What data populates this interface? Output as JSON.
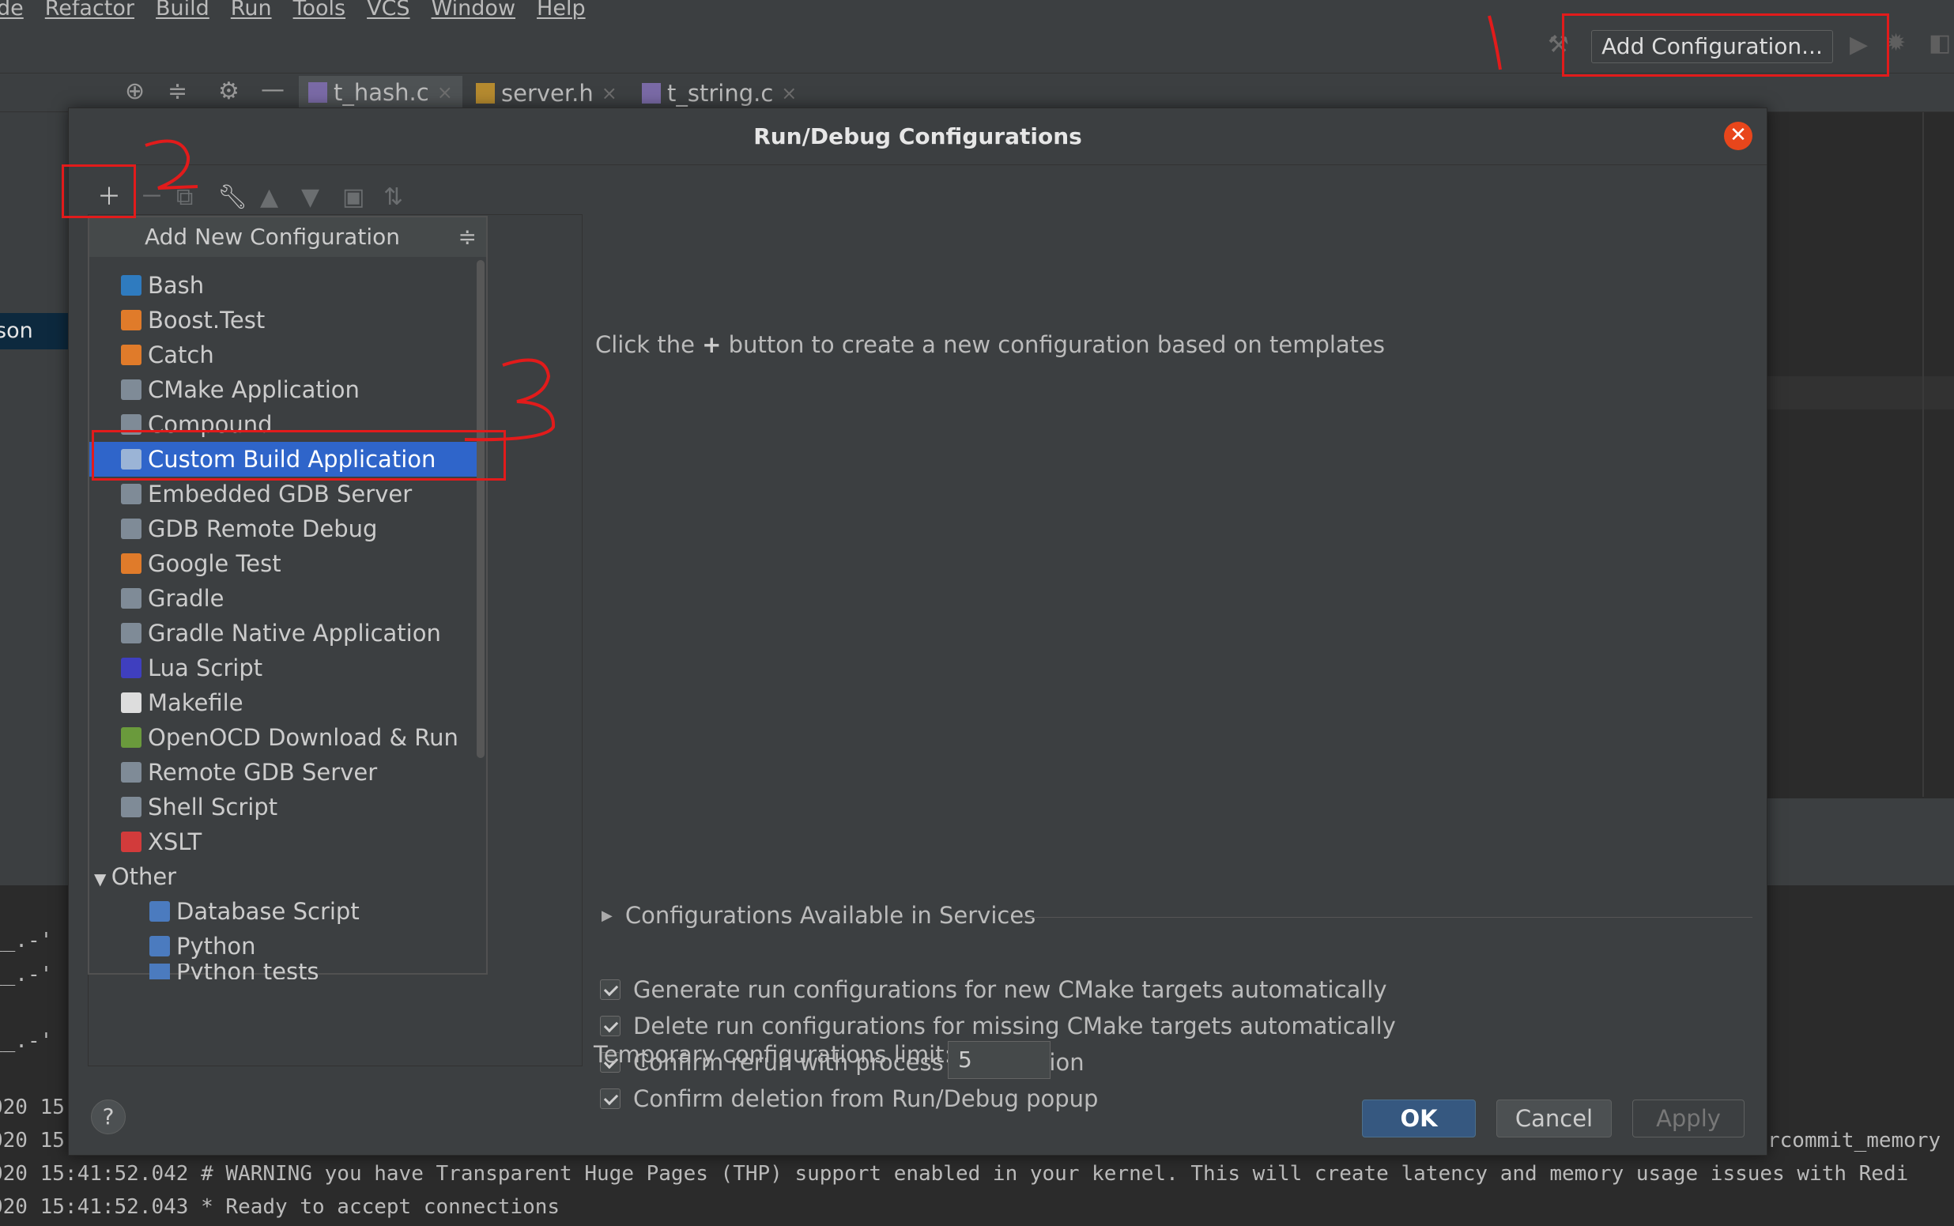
{
  "menubar": {
    "items": [
      "de",
      "Refactor",
      "Build",
      "Run",
      "Tools",
      "VCS",
      "Window",
      "Help"
    ]
  },
  "toolbar": {
    "add_configuration_label": "Add Configuration..."
  },
  "editor_tabs": [
    {
      "label": "t_hash.c",
      "close": "×",
      "active": true
    },
    {
      "label": "server.h",
      "close": "×",
      "active": false
    },
    {
      "label": "t_string.c",
      "close": "×",
      "active": false
    }
  ],
  "left_panel": {
    "selected_item_fragment": "son"
  },
  "dialog": {
    "title": "Run/Debug Configurations",
    "close_glyph": "✕",
    "popup": {
      "header": "Add New Configuration",
      "items": [
        {
          "label": "Bash",
          "icon": "bash-icon",
          "color": "#2f7bbf"
        },
        {
          "label": "Boost.Test",
          "icon": "boost-test-icon",
          "color": "#e07b2a"
        },
        {
          "label": "Catch",
          "icon": "catch-icon",
          "color": "#e07b2a"
        },
        {
          "label": "CMake Application",
          "icon": "cmake-app-icon",
          "color": "#7f8b97"
        },
        {
          "label": "Compound",
          "icon": "compound-icon",
          "color": "#7f8b97"
        },
        {
          "label": "Custom Build Application",
          "icon": "custom-build-icon",
          "color": "#9bb4d6"
        },
        {
          "label": "Embedded GDB Server",
          "icon": "embedded-gdb-icon",
          "color": "#7f8b97"
        },
        {
          "label": "GDB Remote Debug",
          "icon": "gdb-remote-icon",
          "color": "#7f8b97"
        },
        {
          "label": "Google Test",
          "icon": "google-test-icon",
          "color": "#e07b2a"
        },
        {
          "label": "Gradle",
          "icon": "gradle-icon",
          "color": "#7f8b97"
        },
        {
          "label": "Gradle Native Application",
          "icon": "gradle-native-icon",
          "color": "#7f8b97"
        },
        {
          "label": "Lua Script",
          "icon": "lua-icon",
          "color": "#3f3fbf"
        },
        {
          "label": "Makefile",
          "icon": "makefile-icon",
          "color": "#dddddd"
        },
        {
          "label": "OpenOCD Download & Run",
          "icon": "openocd-icon",
          "color": "#6a9a3c"
        },
        {
          "label": "Remote GDB Server",
          "icon": "remote-gdb-icon",
          "color": "#7f8b97"
        },
        {
          "label": "Shell Script",
          "icon": "shell-script-icon",
          "color": "#7f8b97"
        },
        {
          "label": "XSLT",
          "icon": "xslt-icon",
          "color": "#d23b3b"
        }
      ],
      "selected_index": 5,
      "group_label": "Other",
      "group_items": [
        {
          "label": "Database Script",
          "icon": "database-script-icon"
        },
        {
          "label": "Python",
          "icon": "python-icon"
        },
        {
          "label": "Python tests",
          "icon": "python-tests-icon"
        }
      ]
    },
    "hint_before": "Click the",
    "hint_plus": "+",
    "hint_after": "button to create a new configuration based on templates",
    "services_label": "Configurations Available in Services",
    "checkboxes": [
      {
        "label": "Generate run configurations for new CMake targets automatically",
        "checked": true
      },
      {
        "label": "Delete run configurations for missing CMake targets automatically",
        "checked": true
      },
      {
        "label": "Confirm rerun with process termination",
        "checked": true
      },
      {
        "label": "Confirm deletion from Run/Debug popup",
        "checked": true
      }
    ],
    "temp_limit_label": "Temporary configurations limit:",
    "temp_limit_value": "5",
    "help_glyph": "?",
    "ok_label": "OK",
    "cancel_label": "Cancel",
    "apply_label": "Apply"
  },
  "console": {
    "lines": [
      "__.-'",
      "__.-'",
      "__.-'",
      "020 15",
      "020 15",
      "020 15:41:52.042 # WARNING you have Transparent Huge Pages (THP) support enabled in your kernel. This will create latency and memory usage issues with Redi",
      "020 15:41:52.043 * Ready to accept connections"
    ],
    "right_fragment": "rcommit_memory :"
  },
  "annotations": {
    "marks": [
      "1",
      "2",
      "3"
    ],
    "color": "#e21b1b"
  }
}
